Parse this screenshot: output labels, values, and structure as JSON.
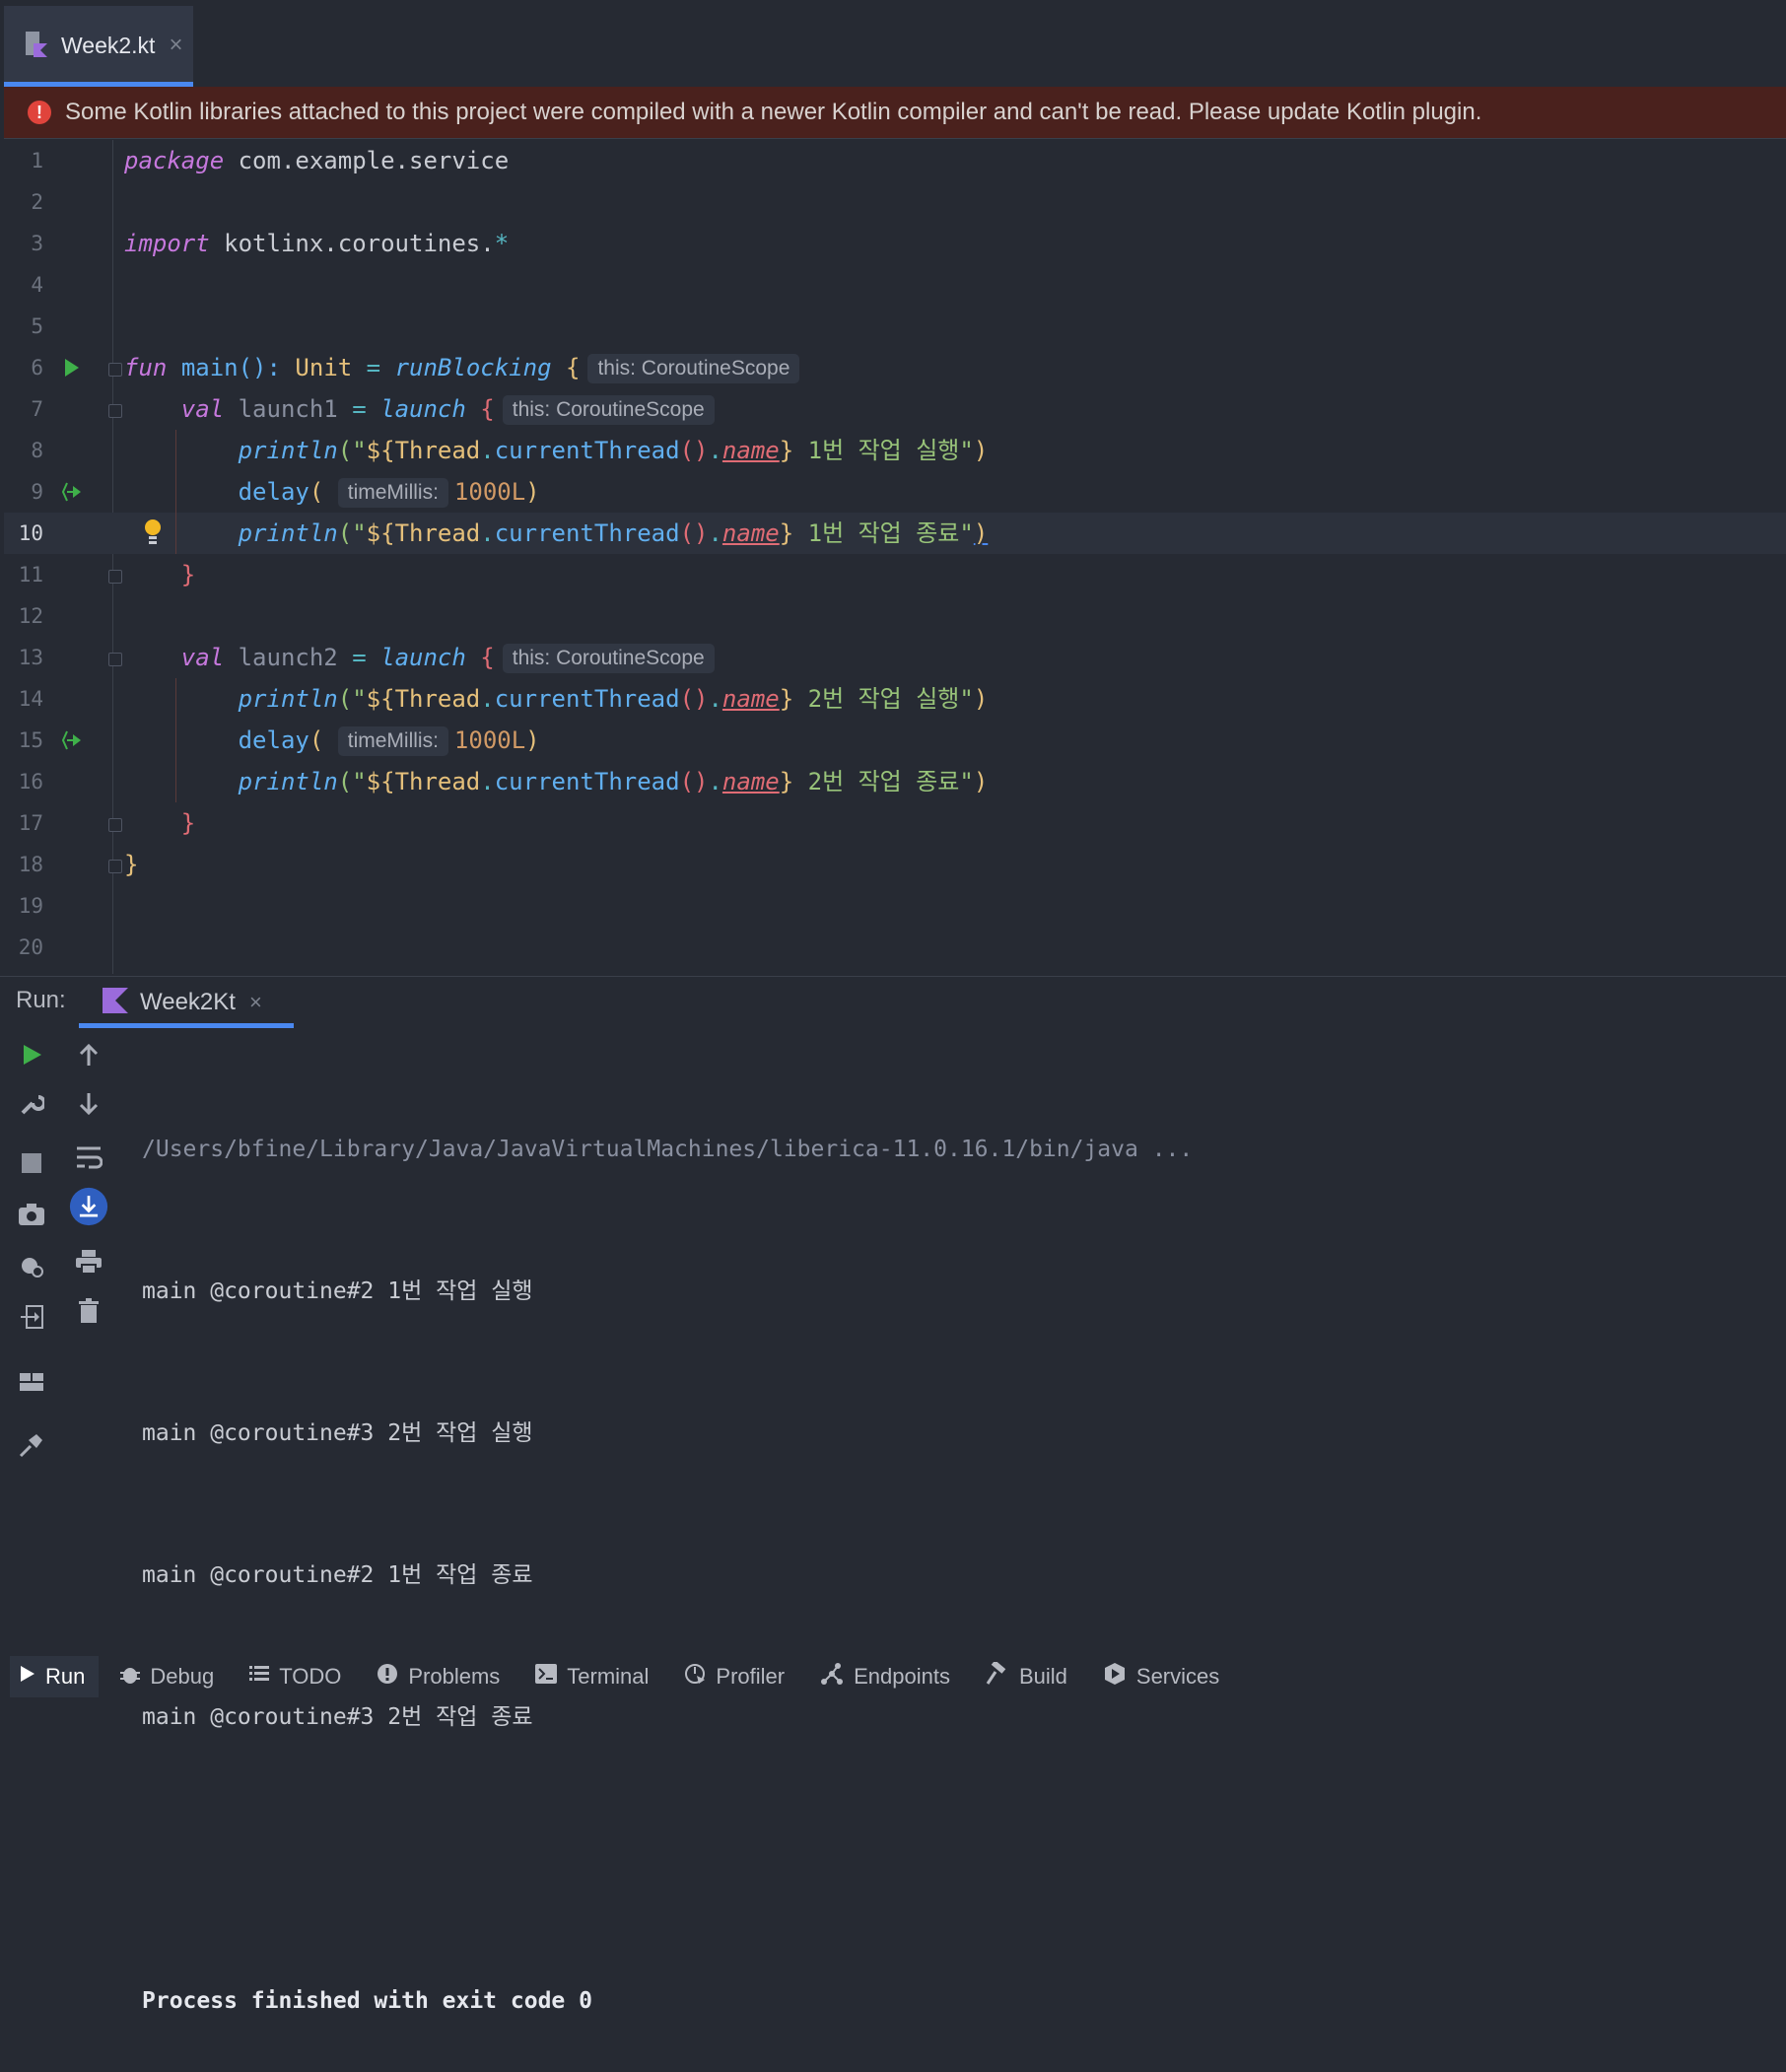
{
  "tab": {
    "label": "Week2.kt",
    "close": "×"
  },
  "banner": {
    "text": "Some Kotlin libraries attached to this project were compiled with a newer Kotlin compiler and can't be read. Please update Kotlin plugin."
  },
  "editor": {
    "line_numbers": [
      "1",
      "2",
      "3",
      "4",
      "5",
      "6",
      "7",
      "8",
      "9",
      "10",
      "11",
      "12",
      "13",
      "14",
      "15",
      "16",
      "17",
      "18",
      "19",
      "20"
    ],
    "current_line": "10",
    "tokens": {
      "package_kw": "package",
      "package_name": "com.example.service",
      "import_kw": "import",
      "import_name": "kotlinx.coroutines.",
      "import_star": "*",
      "fun_kw": "fun",
      "main": "main",
      "parens": "():",
      "unit": "Unit",
      "eq": "=",
      "runBlocking": "runBlocking",
      "open_brace": "{",
      "hint_scope": "this: CoroutineScope",
      "val_kw": "val",
      "launch1": "launch1",
      "launch2": "launch2",
      "launch": "launch",
      "println": "println",
      "open_q": "(\"",
      "tmpl_open": "${",
      "thread": "Thread",
      "dot": ".",
      "currentThread": "currentThread",
      "call": "()",
      "name": "name",
      "tmpl_close": "}",
      "s1_start": " 1번 작업 실행\"",
      "s1_end": " 1번 작업 종료\"",
      "s2_start": " 2번 작업 실행\"",
      "s2_end": " 2번 작업 종료\"",
      "close_paren": ")",
      "delay": "delay",
      "delay_open": "(",
      "hint_time": "timeMillis:",
      "delay_val": "1000L",
      "close_brace": "}"
    }
  },
  "run": {
    "label": "Run:",
    "tab_label": "Week2Kt",
    "tab_close": "×",
    "console_lines": [
      "/Users/bfine/Library/Java/JavaVirtualMachines/liberica-11.0.16.1/bin/java ...",
      "main @coroutine#2 1번 작업 실행",
      "main @coroutine#3 2번 작업 실행",
      "main @coroutine#2 1번 작업 종료",
      "main @coroutine#3 2번 작업 종료",
      "",
      "Process finished with exit code 0"
    ]
  },
  "bottom_bar": [
    {
      "label": "Run",
      "icon": "play-icon"
    },
    {
      "label": "Debug",
      "icon": "bug-icon"
    },
    {
      "label": "TODO",
      "icon": "list-icon"
    },
    {
      "label": "Problems",
      "icon": "warning-icon"
    },
    {
      "label": "Terminal",
      "icon": "terminal-icon"
    },
    {
      "label": "Profiler",
      "icon": "profiler-icon"
    },
    {
      "label": "Endpoints",
      "icon": "endpoints-icon"
    },
    {
      "label": "Build",
      "icon": "hammer-icon"
    },
    {
      "label": "Services",
      "icon": "services-icon"
    }
  ],
  "colors": {
    "accent": "#4a88f0",
    "banner_bg": "#4a211d",
    "error": "#e0443c",
    "run_green": "#3fb04a"
  }
}
